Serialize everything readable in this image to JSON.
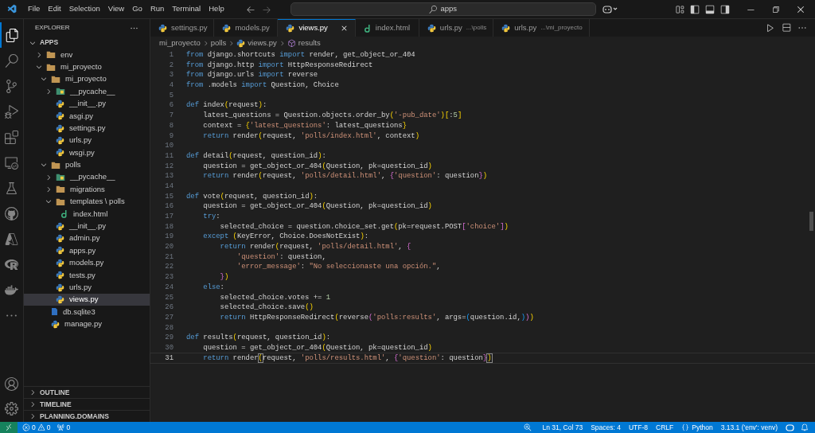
{
  "menu": [
    "File",
    "Edit",
    "Selection",
    "View",
    "Go",
    "Run",
    "Terminal",
    "Help"
  ],
  "search": {
    "value": "apps"
  },
  "sidebar": {
    "title": "EXPLORER",
    "root": {
      "label": "APPS",
      "expanded": true,
      "children": [
        {
          "label": "env",
          "kind": "folder",
          "expanded": false,
          "selected": false
        },
        {
          "label": "mi_proyecto",
          "kind": "folder",
          "expanded": true,
          "selected": false,
          "children": [
            {
              "label": "mi_proyecto",
              "kind": "folder",
              "expanded": true,
              "selected": false,
              "children": [
                {
                  "label": "__pycache__",
                  "kind": "pycache",
                  "expanded": false,
                  "selected": false
                },
                {
                  "label": "__init__.py",
                  "kind": "python",
                  "selected": false
                },
                {
                  "label": "asgi.py",
                  "kind": "python",
                  "selected": false
                },
                {
                  "label": "settings.py",
                  "kind": "python",
                  "selected": false
                },
                {
                  "label": "urls.py",
                  "kind": "python",
                  "selected": false
                },
                {
                  "label": "wsgi.py",
                  "kind": "python",
                  "selected": false
                }
              ]
            },
            {
              "label": "polls",
              "kind": "folder",
              "expanded": true,
              "selected": false,
              "children": [
                {
                  "label": "__pycache__",
                  "kind": "pycache",
                  "expanded": false,
                  "selected": false
                },
                {
                  "label": "migrations",
                  "kind": "folder",
                  "expanded": false,
                  "selected": false
                },
                {
                  "label": "templates \\ polls",
                  "kind": "folder",
                  "expanded": true,
                  "selected": false,
                  "children": [
                    {
                      "label": "index.html",
                      "kind": "django",
                      "selected": false
                    }
                  ]
                },
                {
                  "label": "__init__.py",
                  "kind": "python",
                  "selected": false
                },
                {
                  "label": "admin.py",
                  "kind": "python",
                  "selected": false
                },
                {
                  "label": "apps.py",
                  "kind": "python",
                  "selected": false
                },
                {
                  "label": "models.py",
                  "kind": "python",
                  "selected": false
                },
                {
                  "label": "tests.py",
                  "kind": "python",
                  "selected": false
                },
                {
                  "label": "urls.py",
                  "kind": "python",
                  "selected": false
                },
                {
                  "label": "views.py",
                  "kind": "python",
                  "selected": true
                }
              ]
            },
            {
              "label": "db.sqlite3",
              "kind": "database",
              "selected": false
            },
            {
              "label": "manage.py",
              "kind": "python",
              "selected": false
            }
          ]
        }
      ]
    },
    "sections": [
      {
        "label": "OUTLINE",
        "expanded": false
      },
      {
        "label": "TIMELINE",
        "expanded": false
      },
      {
        "label": "PLANNING.DOMAINS",
        "expanded": false
      }
    ]
  },
  "tabs": [
    {
      "label": "settings.py",
      "kind": "python",
      "selected": false
    },
    {
      "label": "models.py",
      "kind": "python",
      "selected": false
    },
    {
      "label": "views.py",
      "kind": "python",
      "selected": true
    },
    {
      "label": "index.html",
      "kind": "django",
      "selected": false
    },
    {
      "label": "urls.py",
      "description": "...\\polls",
      "kind": "python",
      "selected": false
    },
    {
      "label": "urls.py",
      "description": "...\\mi_proyecto",
      "kind": "python",
      "selected": false
    }
  ],
  "breadcrumb": [
    {
      "label": "mi_proyecto",
      "kind": "folder"
    },
    {
      "label": "polls",
      "kind": "folder"
    },
    {
      "label": "views.py",
      "kind": "python"
    },
    {
      "label": "results",
      "kind": "symbol"
    }
  ],
  "code": [
    {
      "number": "1",
      "selected": false,
      "tokens": [
        {
          "text": "from",
          "kind": "keyword"
        },
        {
          "text": " django.shortcuts ",
          "kind": "plain"
        },
        {
          "text": "import",
          "kind": "keyword"
        },
        {
          "text": " render, get_object_or_404",
          "kind": "plain"
        }
      ]
    },
    {
      "number": "2",
      "selected": false,
      "tokens": [
        {
          "text": "from",
          "kind": "keyword"
        },
        {
          "text": " django.http ",
          "kind": "plain"
        },
        {
          "text": "import",
          "kind": "keyword"
        },
        {
          "text": " HttpResponseRedirect",
          "kind": "plain"
        }
      ]
    },
    {
      "number": "3",
      "selected": false,
      "tokens": [
        {
          "text": "from",
          "kind": "keyword"
        },
        {
          "text": " django.urls ",
          "kind": "plain"
        },
        {
          "text": "import",
          "kind": "keyword"
        },
        {
          "text": " reverse",
          "kind": "plain"
        }
      ]
    },
    {
      "number": "4",
      "selected": false,
      "tokens": [
        {
          "text": "from",
          "kind": "keyword"
        },
        {
          "text": " .models ",
          "kind": "plain"
        },
        {
          "text": "import",
          "kind": "keyword"
        },
        {
          "text": " Question, Choice",
          "kind": "plain"
        }
      ]
    },
    {
      "number": "5",
      "selected": false
    },
    {
      "number": "6",
      "selected": false,
      "tokens": [
        {
          "text": "def",
          "kind": "keyword"
        },
        {
          "text": " index",
          "kind": "plain"
        },
        {
          "text": "(",
          "kind": "bracket1"
        },
        {
          "text": "request",
          "kind": "plain"
        },
        {
          "text": ")",
          "kind": "bracket1"
        },
        {
          "text": ":",
          "kind": "plain"
        }
      ]
    },
    {
      "number": "7",
      "selected": false,
      "tokens": [
        {
          "text": "    latest_questions = Question.objects.order_by",
          "kind": "plain"
        },
        {
          "text": "(",
          "kind": "bracket1"
        },
        {
          "text": "'-pub_date'",
          "kind": "string"
        },
        {
          "text": ")",
          "kind": "bracket1"
        },
        {
          "text": "[",
          "kind": "bracket1"
        },
        {
          "text": ":",
          "kind": "plain"
        },
        {
          "text": "5",
          "kind": "number"
        },
        {
          "text": "]",
          "kind": "bracket1"
        }
      ]
    },
    {
      "number": "8",
      "selected": false,
      "tokens": [
        {
          "text": "    context = ",
          "kind": "plain"
        },
        {
          "text": "{",
          "kind": "bracket1"
        },
        {
          "text": "'latest_questions'",
          "kind": "string"
        },
        {
          "text": ": latest_questions",
          "kind": "plain"
        },
        {
          "text": "}",
          "kind": "bracket1"
        }
      ]
    },
    {
      "number": "9",
      "selected": false,
      "tokens": [
        {
          "text": "    return",
          "kind": "keyword"
        },
        {
          "text": " render",
          "kind": "plain"
        },
        {
          "text": "(",
          "kind": "bracket1"
        },
        {
          "text": "request, ",
          "kind": "plain"
        },
        {
          "text": "'polls/index.html'",
          "kind": "string"
        },
        {
          "text": ", context",
          "kind": "plain"
        },
        {
          "text": ")",
          "kind": "bracket1"
        }
      ]
    },
    {
      "number": "10",
      "selected": false
    },
    {
      "number": "11",
      "selected": false,
      "tokens": [
        {
          "text": "def",
          "kind": "keyword"
        },
        {
          "text": " detail",
          "kind": "plain"
        },
        {
          "text": "(",
          "kind": "bracket1"
        },
        {
          "text": "request, question_id",
          "kind": "plain"
        },
        {
          "text": ")",
          "kind": "bracket1"
        },
        {
          "text": ":",
          "kind": "plain"
        }
      ]
    },
    {
      "number": "12",
      "selected": false,
      "tokens": [
        {
          "text": "    question = get_object_or_404",
          "kind": "plain"
        },
        {
          "text": "(",
          "kind": "bracket1"
        },
        {
          "text": "Question, pk=question_id",
          "kind": "plain"
        },
        {
          "text": ")",
          "kind": "bracket1"
        }
      ]
    },
    {
      "number": "13",
      "selected": false,
      "tokens": [
        {
          "text": "    return",
          "kind": "keyword"
        },
        {
          "text": " render",
          "kind": "plain"
        },
        {
          "text": "(",
          "kind": "bracket1"
        },
        {
          "text": "request, ",
          "kind": "plain"
        },
        {
          "text": "'polls/detail.html'",
          "kind": "string"
        },
        {
          "text": ", ",
          "kind": "plain"
        },
        {
          "text": "{",
          "kind": "bracket2"
        },
        {
          "text": "'question'",
          "kind": "string"
        },
        {
          "text": ": question",
          "kind": "plain"
        },
        {
          "text": "}",
          "kind": "bracket2"
        },
        {
          "text": ")",
          "kind": "bracket1"
        }
      ]
    },
    {
      "number": "14",
      "selected": false
    },
    {
      "number": "15",
      "selected": false,
      "tokens": [
        {
          "text": "def",
          "kind": "keyword"
        },
        {
          "text": " vote",
          "kind": "plain"
        },
        {
          "text": "(",
          "kind": "bracket1"
        },
        {
          "text": "request, question_id",
          "kind": "plain"
        },
        {
          "text": ")",
          "kind": "bracket1"
        },
        {
          "text": ":",
          "kind": "plain"
        }
      ]
    },
    {
      "number": "16",
      "selected": false,
      "tokens": [
        {
          "text": "    question = get_object_or_404",
          "kind": "plain"
        },
        {
          "text": "(",
          "kind": "bracket1"
        },
        {
          "text": "Question, pk=question_id",
          "kind": "plain"
        },
        {
          "text": ")",
          "kind": "bracket1"
        }
      ]
    },
    {
      "number": "17",
      "selected": false,
      "tokens": [
        {
          "text": "    try",
          "kind": "keyword"
        },
        {
          "text": ":",
          "kind": "plain"
        }
      ]
    },
    {
      "number": "18",
      "selected": false,
      "tokens": [
        {
          "text": "        selected_choice = question.choice_set.get",
          "kind": "plain"
        },
        {
          "text": "(",
          "kind": "bracket1"
        },
        {
          "text": "pk=request.POST",
          "kind": "plain"
        },
        {
          "text": "[",
          "kind": "bracket2"
        },
        {
          "text": "'choice'",
          "kind": "string"
        },
        {
          "text": "]",
          "kind": "bracket2"
        },
        {
          "text": ")",
          "kind": "bracket1"
        }
      ]
    },
    {
      "number": "19",
      "selected": false,
      "tokens": [
        {
          "text": "    except",
          "kind": "keyword"
        },
        {
          "text": " (",
          "kind": "bracket1"
        },
        {
          "text": "KeyError, Choice.DoesNotExist",
          "kind": "plain"
        },
        {
          "text": ")",
          "kind": "bracket1"
        },
        {
          "text": ":",
          "kind": "plain"
        }
      ]
    },
    {
      "number": "20",
      "selected": false,
      "tokens": [
        {
          "text": "        return",
          "kind": "keyword"
        },
        {
          "text": " render",
          "kind": "plain"
        },
        {
          "text": "(",
          "kind": "bracket1"
        },
        {
          "text": "request, ",
          "kind": "plain"
        },
        {
          "text": "'polls/detail.html'",
          "kind": "string"
        },
        {
          "text": ", ",
          "kind": "plain"
        },
        {
          "text": "{",
          "kind": "bracket2"
        }
      ]
    },
    {
      "number": "21",
      "selected": false,
      "tokens": [
        {
          "text": "            'question'",
          "kind": "string"
        },
        {
          "text": ": question,",
          "kind": "plain"
        }
      ]
    },
    {
      "number": "22",
      "selected": false,
      "tokens": [
        {
          "text": "            'error_message'",
          "kind": "string"
        },
        {
          "text": ": ",
          "kind": "plain"
        },
        {
          "text": "\"No seleccionaste una opción.\"",
          "kind": "string"
        },
        {
          "text": ",",
          "kind": "plain"
        }
      ]
    },
    {
      "number": "23",
      "selected": false,
      "tokens": [
        {
          "text": "        }",
          "kind": "bracket2"
        },
        {
          "text": ")",
          "kind": "bracket1"
        }
      ]
    },
    {
      "number": "24",
      "selected": false,
      "tokens": [
        {
          "text": "    else",
          "kind": "keyword"
        },
        {
          "text": ":",
          "kind": "plain"
        }
      ]
    },
    {
      "number": "25",
      "selected": false,
      "tokens": [
        {
          "text": "        selected_choice.votes += ",
          "kind": "plain"
        },
        {
          "text": "1",
          "kind": "number"
        }
      ]
    },
    {
      "number": "26",
      "selected": false,
      "tokens": [
        {
          "text": "        selected_choice.save",
          "kind": "plain"
        },
        {
          "text": "()",
          "kind": "bracket1"
        }
      ]
    },
    {
      "number": "27",
      "selected": false,
      "tokens": [
        {
          "text": "        return",
          "kind": "keyword"
        },
        {
          "text": " HttpResponseRedirect",
          "kind": "plain"
        },
        {
          "text": "(",
          "kind": "bracket1"
        },
        {
          "text": "reverse",
          "kind": "plain"
        },
        {
          "text": "(",
          "kind": "bracket2"
        },
        {
          "text": "'polls:results'",
          "kind": "string"
        },
        {
          "text": ", args=",
          "kind": "plain"
        },
        {
          "text": "(",
          "kind": "bracket3"
        },
        {
          "text": "question.id,",
          "kind": "plain"
        },
        {
          "text": ")",
          "kind": "bracket3"
        },
        {
          "text": ")",
          "kind": "bracket2"
        },
        {
          "text": ")",
          "kind": "bracket1"
        }
      ]
    },
    {
      "number": "28",
      "selected": false
    },
    {
      "number": "29",
      "selected": false,
      "tokens": [
        {
          "text": "def",
          "kind": "keyword"
        },
        {
          "text": " results",
          "kind": "plain"
        },
        {
          "text": "(",
          "kind": "bracket1"
        },
        {
          "text": "request, question_id",
          "kind": "plain"
        },
        {
          "text": ")",
          "kind": "bracket1"
        },
        {
          "text": ":",
          "kind": "plain"
        }
      ]
    },
    {
      "number": "30",
      "selected": false,
      "tokens": [
        {
          "text": "    question = get_object_or_404",
          "kind": "plain"
        },
        {
          "text": "(",
          "kind": "bracket1"
        },
        {
          "text": "Question, pk=question_id",
          "kind": "plain"
        },
        {
          "text": ")",
          "kind": "bracket1"
        }
      ]
    },
    {
      "number": "31",
      "selected": true,
      "tokens": [
        {
          "text": "    return",
          "kind": "keyword"
        },
        {
          "text": " render",
          "kind": "plain"
        },
        {
          "text": "(",
          "kind": "matched"
        },
        {
          "text": "request, ",
          "kind": "plain"
        },
        {
          "text": "'polls/results.html'",
          "kind": "string"
        },
        {
          "text": ", ",
          "kind": "plain"
        },
        {
          "text": "{",
          "kind": "bracket2"
        },
        {
          "text": "'question'",
          "kind": "string"
        },
        {
          "text": ": question",
          "kind": "plain"
        },
        {
          "text": "}",
          "kind": "bracket2"
        },
        {
          "text": ")",
          "kind": "matched"
        }
      ]
    }
  ],
  "status_bar": {
    "errors": "0",
    "warnings": "0",
    "ports": "0",
    "items": [
      {
        "label": "Ln 31, Col 73",
        "kind": "text"
      },
      {
        "label": "Spaces: 4",
        "kind": "text"
      },
      {
        "label": "UTF-8",
        "kind": "text"
      },
      {
        "label": "CRLF",
        "kind": "text"
      },
      {
        "label": "Python",
        "kind": "language"
      },
      {
        "label": "3.13.1 ('env': venv)",
        "kind": "text"
      }
    ]
  }
}
